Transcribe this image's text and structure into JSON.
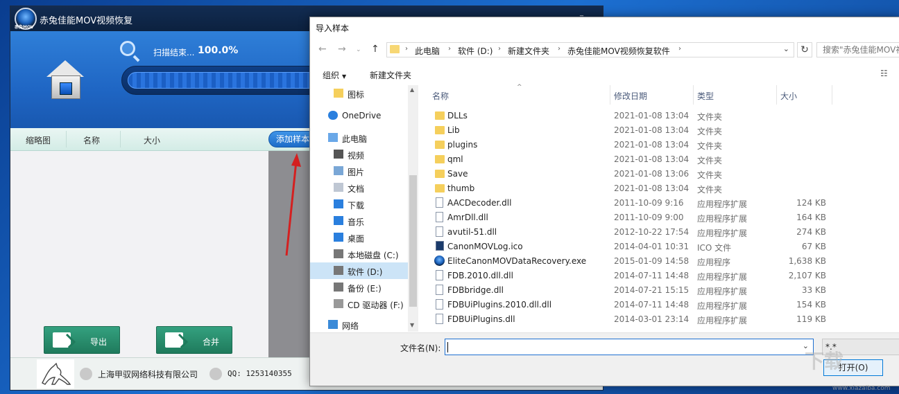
{
  "app": {
    "title": "赤兔佳能MOV视频恢复",
    "logo_text": "赤兔MOV",
    "min_label": "_",
    "scan_label": "扫描结束...",
    "scan_percent": "100.0%",
    "progress": 1.0,
    "columns": [
      "缩略图",
      "名称",
      "大小"
    ],
    "add_sample": "添加样本",
    "export_label": "导出",
    "merge_label": "合并",
    "company": "上海甲驭网络科技有限公司",
    "qq": "QQ: 1253140355"
  },
  "dialog": {
    "title": "导入样本",
    "breadcrumbs": [
      "此电脑",
      "软件 (D:)",
      "新建文件夹",
      "赤兔佳能MOV视频恢复软件"
    ],
    "search_placeholder": "搜索\"赤兔佳能MOV视...",
    "organize": "组织",
    "new_folder": "新建文件夹",
    "nav_items": [
      {
        "label": "图标",
        "icon": "folder-icon"
      },
      {
        "label": "OneDrive",
        "icon": "cloud-icon"
      },
      {
        "label": "此电脑",
        "icon": "computer-icon"
      },
      {
        "label": "视频",
        "icon": "video-icon"
      },
      {
        "label": "图片",
        "icon": "picture-icon"
      },
      {
        "label": "文档",
        "icon": "document-icon"
      },
      {
        "label": "下载",
        "icon": "download-icon"
      },
      {
        "label": "音乐",
        "icon": "music-icon"
      },
      {
        "label": "桌面",
        "icon": "desktop-icon"
      },
      {
        "label": "本地磁盘 (C:)",
        "icon": "drive-icon"
      },
      {
        "label": "软件 (D:)",
        "icon": "drive-icon",
        "selected": true
      },
      {
        "label": "备份 (E:)",
        "icon": "drive-icon"
      },
      {
        "label": "CD 驱动器 (F:)",
        "icon": "cd-drive-icon"
      },
      {
        "label": "网络",
        "icon": "network-icon"
      }
    ],
    "headers": {
      "name": "名称",
      "date": "修改日期",
      "type": "类型",
      "size": "大小"
    },
    "files": [
      {
        "name": "DLLs",
        "date": "2021-01-08 13:04",
        "type": "文件夹",
        "size": "",
        "kind": "folder"
      },
      {
        "name": "Lib",
        "date": "2021-01-08 13:04",
        "type": "文件夹",
        "size": "",
        "kind": "folder"
      },
      {
        "name": "plugins",
        "date": "2021-01-08 13:04",
        "type": "文件夹",
        "size": "",
        "kind": "folder"
      },
      {
        "name": "qml",
        "date": "2021-01-08 13:04",
        "type": "文件夹",
        "size": "",
        "kind": "folder"
      },
      {
        "name": "Save",
        "date": "2021-01-08 13:06",
        "type": "文件夹",
        "size": "",
        "kind": "folder"
      },
      {
        "name": "thumb",
        "date": "2021-01-08 13:04",
        "type": "文件夹",
        "size": "",
        "kind": "folder"
      },
      {
        "name": "AACDecoder.dll",
        "date": "2011-10-09 9:16",
        "type": "应用程序扩展",
        "size": "124 KB",
        "kind": "file"
      },
      {
        "name": "AmrDll.dll",
        "date": "2011-10-09 9:00",
        "type": "应用程序扩展",
        "size": "164 KB",
        "kind": "file"
      },
      {
        "name": "avutil-51.dll",
        "date": "2012-10-22 17:54",
        "type": "应用程序扩展",
        "size": "274 KB",
        "kind": "file"
      },
      {
        "name": "CanonMOVLog.ico",
        "date": "2014-04-01 10:31",
        "type": "ICO 文件",
        "size": "67 KB",
        "kind": "ico"
      },
      {
        "name": "EliteCanonMOVDataRecovery.exe",
        "date": "2015-01-09 14:58",
        "type": "应用程序",
        "size": "1,638 KB",
        "kind": "exe"
      },
      {
        "name": "FDB.2010.dll.dll",
        "date": "2014-07-11 14:48",
        "type": "应用程序扩展",
        "size": "2,107 KB",
        "kind": "file"
      },
      {
        "name": "FDBbridge.dll",
        "date": "2014-07-21 15:15",
        "type": "应用程序扩展",
        "size": "33 KB",
        "kind": "file"
      },
      {
        "name": "FDBUiPlugins.2010.dll.dll",
        "date": "2014-07-11 14:48",
        "type": "应用程序扩展",
        "size": "154 KB",
        "kind": "file"
      },
      {
        "name": "FDBUiPlugins.dll",
        "date": "2014-03-01 23:14",
        "type": "应用程序扩展",
        "size": "119 KB",
        "kind": "file"
      }
    ],
    "filename_label": "文件名(N):",
    "filename_value": "",
    "filter": "*.*",
    "open_label": "打开(O)"
  },
  "watermark": {
    "text": "下载",
    "url": "www.xiazaiba.com"
  }
}
